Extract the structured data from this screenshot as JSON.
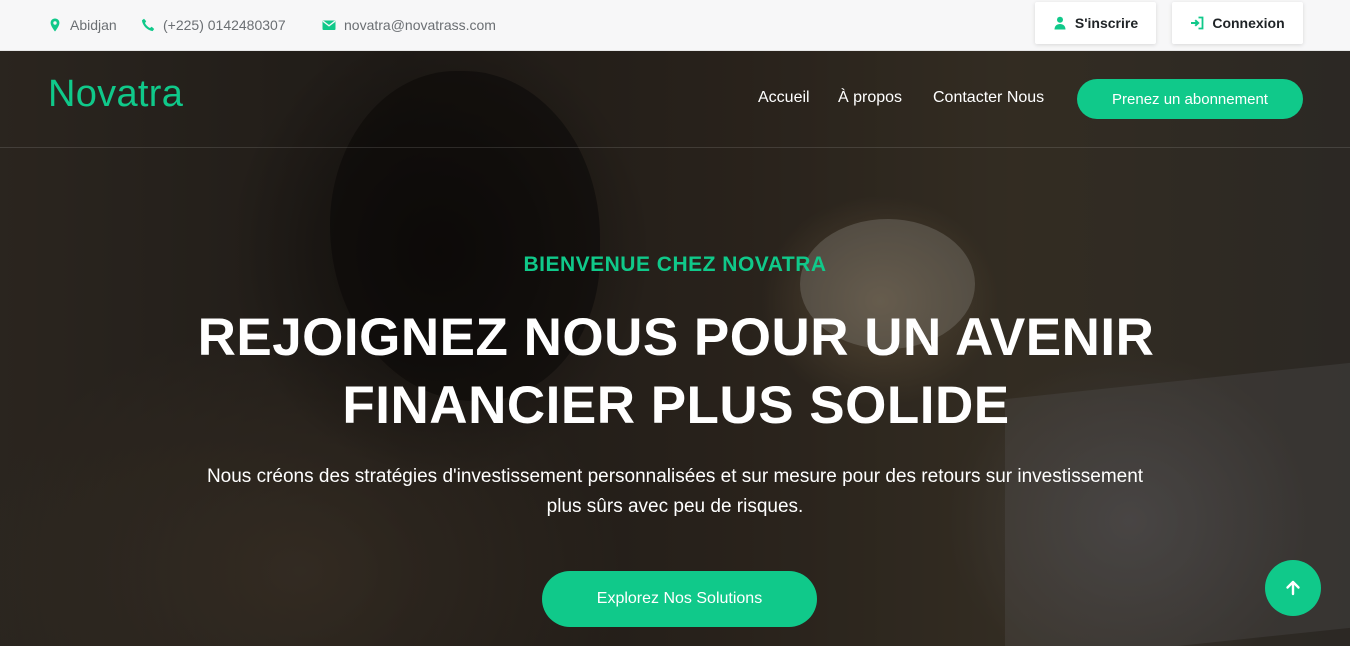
{
  "topbar": {
    "location": {
      "icon": "map-marker-icon",
      "text": "Abidjan"
    },
    "phone": {
      "icon": "phone-icon",
      "text": "(+225) 0142480307"
    },
    "email": {
      "icon": "envelope-icon",
      "text": "novatra@novatrass.com"
    },
    "signup": {
      "icon": "user-icon",
      "label": "S'inscrire"
    },
    "login": {
      "icon": "sign-in-icon",
      "label": "Connexion"
    }
  },
  "nav": {
    "brand": "Novatra",
    "links": [
      "Accueil",
      "À propos",
      "Contacter Nous"
    ],
    "subscribe_label": "Prenez un abonnement"
  },
  "hero": {
    "eyebrow": "BIENVENUE CHEZ NOVATRA",
    "headline": [
      "REJOIGNEZ NOUS POUR UN AVENIR",
      "FINANCIER PLUS SOLIDE"
    ],
    "lead": [
      "Nous créons des stratégies d'investissement personnalisées et sur mesure pour des retours sur investissement",
      "plus sûrs avec peu de risques."
    ],
    "cta_label": "Explorez Nos Solutions"
  },
  "back_to_top": {
    "icon": "arrow-up-icon"
  },
  "colors": {
    "accent": "#10c98a",
    "topbar_bg": "#f7f7f8",
    "topbar_text": "#6b6f73"
  }
}
